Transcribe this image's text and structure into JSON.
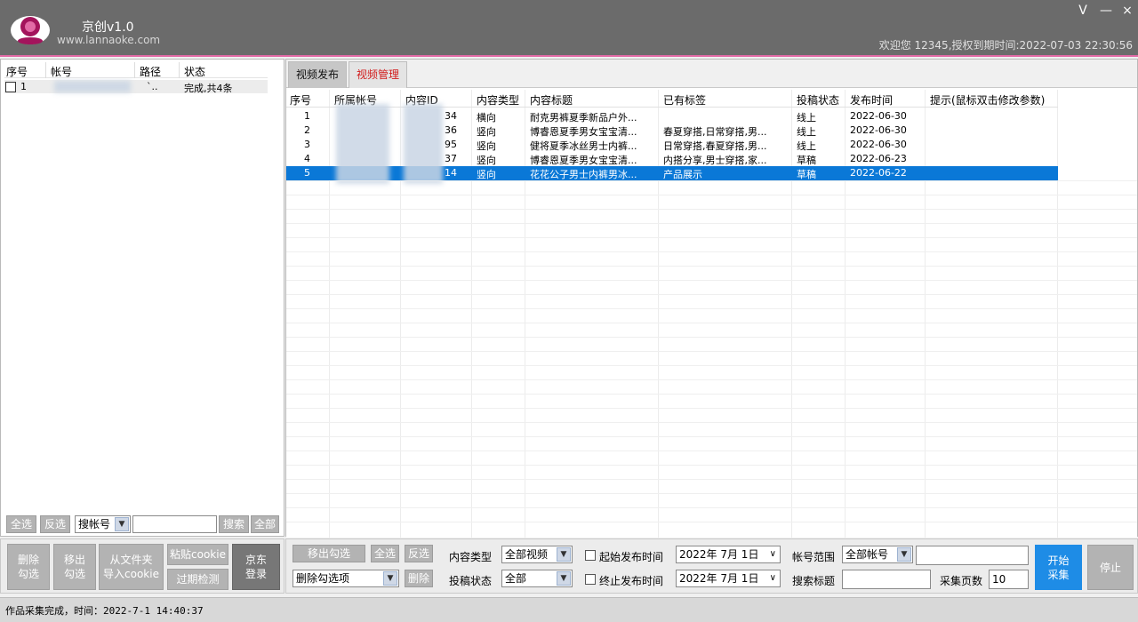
{
  "app": {
    "title": "京创v1.0",
    "url": "www.lannaoke.com",
    "welcome": "欢迎您 12345,授权到期时间:2022-07-03 22:30:56",
    "window_buttons": [
      "V",
      "—",
      "×"
    ]
  },
  "left_grid": {
    "headers": [
      "序号",
      "帐号",
      "路径",
      "状态"
    ],
    "rows": [
      {
        "index": "1",
        "account": "",
        "path": "`..",
        "status": "完成,共4条"
      }
    ]
  },
  "left_toolbar": {
    "select_all": "全选",
    "invert": "反选",
    "search_type": "搜帐号",
    "search_value": "",
    "search": "搜索",
    "all": "全部"
  },
  "left_buttons": {
    "delete_checked": "删除\n勾选",
    "move_checked": "移出\n勾选",
    "import_cookie": "从文件夹\n导入cookie",
    "paste_cookie": "粘贴cookie",
    "expired_check": "过期检测",
    "jd_login": "京东\n登录"
  },
  "tabs": [
    "视频发布",
    "视频管理"
  ],
  "grid": {
    "headers": [
      "序号",
      "所属帐号",
      "内容ID",
      "内容类型",
      "内容标题",
      "已有标签",
      "投稿状态",
      "发布时间",
      "提示(鼠标双击修改参数)"
    ],
    "rows": [
      {
        "index": "1",
        "account": "",
        "content_id": "34",
        "type": "横向",
        "title": "耐克男裤夏季新品户外...",
        "tags": "",
        "status": "线上",
        "time": "2022-06-30",
        "hint": ""
      },
      {
        "index": "2",
        "account": "",
        "content_id": "36",
        "type": "竖向",
        "title": "博睿恩夏季男女宝宝清...",
        "tags": "春夏穿搭,日常穿搭,男...",
        "status": "线上",
        "time": "2022-06-30",
        "hint": ""
      },
      {
        "index": "3",
        "account": "",
        "content_id": "95",
        "type": "竖向",
        "title": "健将夏季冰丝男士内裤...",
        "tags": "日常穿搭,春夏穿搭,男...",
        "status": "线上",
        "time": "2022-06-30",
        "hint": ""
      },
      {
        "index": "4",
        "account": "",
        "content_id": "37",
        "type": "竖向",
        "title": "博睿恩夏季男女宝宝清...",
        "tags": "内搭分享,男士穿搭,家...",
        "status": "草稿",
        "time": "2022-06-23",
        "hint": ""
      },
      {
        "index": "5",
        "account": "",
        "content_id": "14",
        "type": "竖向",
        "title": "花花公子男士内裤男冰...",
        "tags": "产品展示",
        "status": "草稿",
        "time": "2022-06-22",
        "hint": ""
      }
    ],
    "selected_row": 5
  },
  "controls": {
    "move_checked": "移出勾选",
    "select_all": "全选",
    "invert": "反选",
    "delete_option": "删除勾选项",
    "delete": "删除",
    "content_type_label": "内容类型",
    "content_type_value": "全部视频",
    "post_status_label": "投稿状态",
    "post_status_value": "全部",
    "start_time_label": "起始发布时间",
    "start_time_value": "2022年  7月  1日",
    "end_time_label": "终止发布时间",
    "end_time_value": "2022年  7月  1日",
    "account_range_label": "帐号范围",
    "account_range_value": "全部帐号",
    "account_range_input": "",
    "search_title_label": "搜索标题",
    "search_title_value": "",
    "pages_label": "采集页数",
    "pages_value": "10",
    "start_collect": "开始\n采集",
    "stop": "停止"
  },
  "status_bar": {
    "text": "作品采集完成，时间：2022-7-1 14:40:37"
  },
  "colors": {
    "title_bar": "#6b6b6b",
    "accent_pink": "#e26aa6",
    "selection_blue": "#0a78d7",
    "action_blue": "#1e8ce6",
    "tab_active_red": "#d11a1a"
  }
}
